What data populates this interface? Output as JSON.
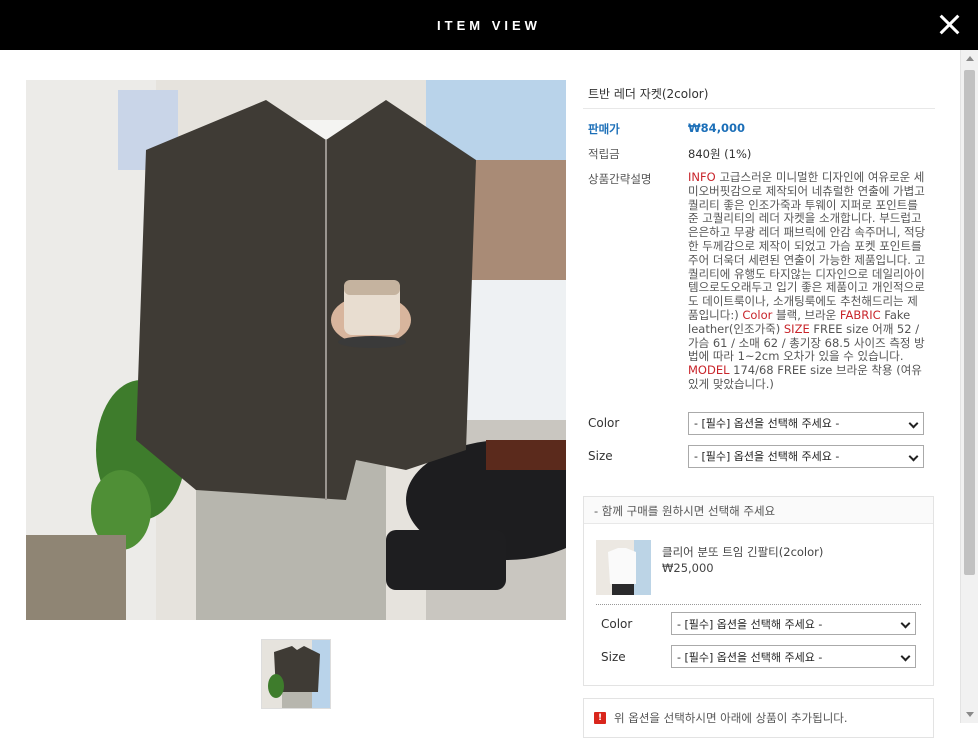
{
  "header": {
    "title": "ITEM VIEW"
  },
  "product": {
    "name": "트반 레더 자켓(2color)",
    "price_label": "판매가",
    "price": "₩84,000",
    "mileage_label": "적립금",
    "mileage": "840원 (1%)",
    "desc_label": "상품간략설명",
    "desc_info": "INFO",
    "desc_text1": " 고급스러운 미니멀한 디자인에 여유로운 세미오버핏감으로 제작되어 네츄럴한 연출에 가볍고 퀄리티 좋은 인조가죽과 투웨이 지퍼로 포인트를 준 고퀄리티의 레더 자켓을 소개합니다. 부드럽고 은은하고 무광 레더 패브릭에 안감 속주머니, 적당한 두께감으로 제작이 되었고 가슴 포켓 포인트를 주어 더욱더 세련된 연출이 가능한 제품입니다. 고퀄리티에 유행도 타지않는 디자인으로 데일리아이템으로도오래두고 입기 좋은 제품이고 개인적으로도 데이트룩이나, 소개팅룩에도 추천해드리는 제품입니다:) ",
    "desc_color": "Color",
    "desc_text2": " 블랙, 브라운 ",
    "desc_fabric": "FABRIC",
    "desc_text3": " Fake leather(인조가죽) ",
    "desc_size": "SIZE",
    "desc_text4": " FREE size 어깨 52 / 가슴 61 / 소매 62 / 총기장 68.5 사이즈 측정 방법에 따라 1~2cm 오차가 있을 수 있습니다. ",
    "desc_model": "MODEL",
    "desc_text5": " 174/68 FREE size 브라운 착용 (여유있게 맞았습니다.)"
  },
  "options": {
    "color_label": "Color",
    "size_label": "Size",
    "placeholder": "- [필수] 옵션을 선택해 주세요 -"
  },
  "addon": {
    "heading": "- 함께 구매를 원하시면 선택해 주세요",
    "item_name": "클리어 분또 트임 긴팔티(2color)",
    "item_price": "₩25,000",
    "color_label": "Color",
    "size_label": "Size",
    "placeholder": "- [필수] 옵션을 선택해 주세요 -"
  },
  "notice": {
    "icon": "warning-icon",
    "text": "위 옵션을 선택하시면 아래에 상품이 추가됩니다."
  },
  "colors": {
    "header_bg": "#000000",
    "price": "#1c6fb8",
    "highlight": "#c8242a"
  }
}
